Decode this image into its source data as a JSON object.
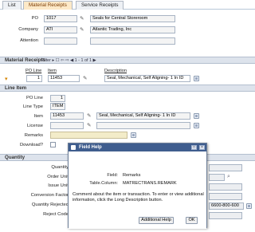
{
  "tabs": [
    "List",
    "Material Receipts",
    "Service Receipts"
  ],
  "header": {
    "po_label": "PO",
    "po_value": "1017",
    "po_desc": "Seals for Central Storeroom",
    "company_label": "Company",
    "company_value": "ATI",
    "company_desc": "Atlantic Trading, Inc",
    "attention_label": "Attention"
  },
  "receipts": {
    "title": "Material Receipts",
    "toolbar": "Filter ▸ ☐ ⇦ ⇨ ◀ 1 - 1 of 1 ▶",
    "col_poline": "PO Line",
    "col_item": "Item",
    "col_desc": "Description",
    "row_poline": "1",
    "row_item": "11453",
    "row_desc": "Seal, Mechanical, Self Aligning- 1 In ID"
  },
  "lineitem": {
    "title": "Line Item",
    "poline_label": "PO Line",
    "poline_value": "1",
    "linetype_label": "Line Type",
    "linetype_value": "ITEM",
    "item_label": "Item",
    "item_value": "11453",
    "item_desc": "Seal, Mechanical, Self Aligning- 1 In ID",
    "license_label": "License",
    "remarks_label": "Remarks",
    "download_label": "Download?"
  },
  "quantity": {
    "title": "Quantity",
    "labels": [
      "Quantity",
      "Order Unit",
      "Issue Unit",
      "Conversion Factor",
      "Quantity Rejected",
      "Reject Code"
    ],
    "rejected_right": "6600-800-600"
  },
  "dialog": {
    "title": "Field Help",
    "field_label": "Field:",
    "field_value": "Remarks",
    "table_label": "Table.Column:",
    "table_value": "MATRECTRANS.REMARK",
    "text": "Comment about the item or transaction. To enter or view additional information, click the Long Description button.",
    "additional_help": "Additional Help",
    "ok": "OK"
  }
}
